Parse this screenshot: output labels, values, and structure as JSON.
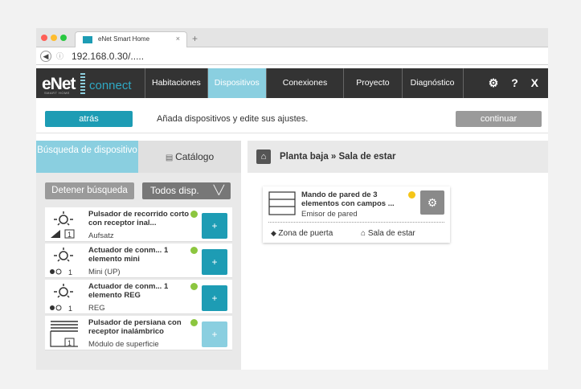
{
  "browser": {
    "tab_title": "eNet Smart Home",
    "tab_close": "×",
    "new_tab": "+",
    "url": "192.168.0.30/.....",
    "traffic_lights": [
      "#ff5f57",
      "#febc2e",
      "#28c840"
    ]
  },
  "app": {
    "logo_text": "eNet",
    "logo_subtext": "SMART HOME",
    "logo_connect": "connect",
    "nav": [
      {
        "label": "Habitaciones"
      },
      {
        "label": "Dispositivos",
        "active": true
      },
      {
        "label": "Conexiones"
      },
      {
        "label": "Proyecto"
      },
      {
        "label": "Diagnóstico"
      }
    ],
    "header_icons": {
      "settings": "⚙",
      "help": "?",
      "close": "X"
    },
    "colors": {
      "accent": "#1d9cb4",
      "active_tab": "#8acfe0",
      "header": "#333333",
      "status_green": "#8cc63f",
      "status_yellow": "#f5c518"
    }
  },
  "actionbar": {
    "back_label": "atrás",
    "hint": "Añada dispositivos y edite sus ajustes.",
    "continue_label": "continuar"
  },
  "left": {
    "tab_search": "Búsqueda de dispositivo",
    "tab_catalog": "Catálogo",
    "stop_label": "Detener búsqueda",
    "filter_label": "Todos disp.",
    "devices": [
      {
        "name": "Pulsador de recorrido corto con receptor inal...",
        "type": "Aufsatz",
        "add": "+",
        "channel": "1"
      },
      {
        "name": "Actuador de conm... 1 elemento mini",
        "type": "Mini (UP)",
        "add": "+",
        "channel": "1"
      },
      {
        "name": "Actuador de conm... 1 elemento REG",
        "type": "REG",
        "add": "+",
        "channel": "1"
      },
      {
        "name": "Pulsador de persiana con receptor inalámbrico",
        "type": "Módulo de superficie",
        "add": "+",
        "channel": "1"
      }
    ]
  },
  "right": {
    "breadcrumb": "Planta baja » Sala de estar",
    "card": {
      "name": "Mando de pared de 3 elementos con campos ...",
      "type": "Emisor de pared",
      "zone": "Zona de puerta",
      "room": "Sala de estar"
    }
  }
}
